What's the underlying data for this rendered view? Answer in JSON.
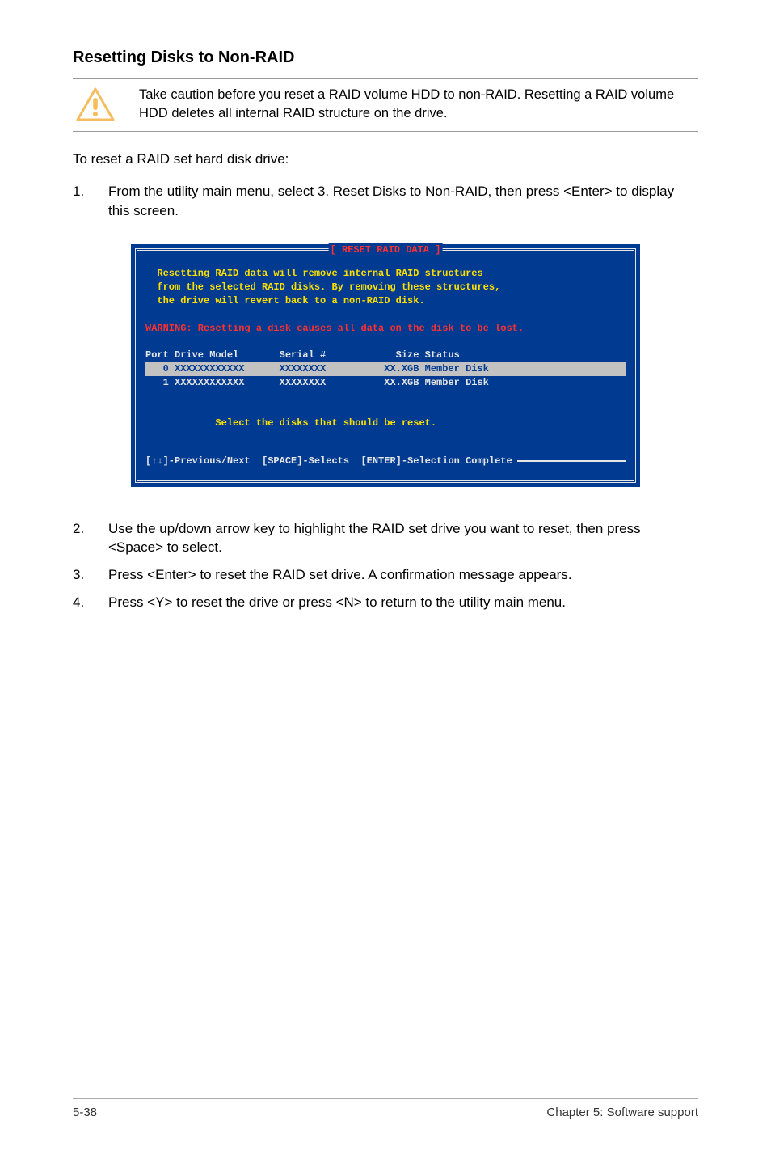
{
  "heading": "Resetting Disks to Non-RAID",
  "callout": {
    "text": "Take caution before you reset a RAID volume HDD to non-RAID. Resetting a RAID volume HDD deletes all internal RAID structure on the drive."
  },
  "intro": "To reset a RAID set hard disk drive:",
  "steps": [
    {
      "num": "1.",
      "text": "From the utility main menu, select 3. Reset Disks to Non-RAID, then press <Enter> to display this screen."
    }
  ],
  "terminal": {
    "title": "[ RESET RAID DATA ]",
    "msg1": "  Resetting RAID data will remove internal RAID structures",
    "msg2": "  from the selected RAID disks. By removing these structures,",
    "msg3": "  the drive will revert back to a non-RAID disk.",
    "warn": "WARNING: Resetting a disk causes all data on the disk to be lost.",
    "header": "Port Drive Model       Serial #            Size Status",
    "row0": "   0 XXXXXXXXXXXX      XXXXXXXX          XX.XGB Member Disk     ",
    "row1": "   1 XXXXXXXXXXXX      XXXXXXXX          XX.XGB Member Disk",
    "prompt": "            Select the disks that should be reset.",
    "help": "[↑↓]-Previous/Next  [SPACE]-Selects  [ENTER]-Selection Complete"
  },
  "steps_after": [
    {
      "num": "2.",
      "text": "Use the up/down arrow key to highlight the RAID set drive you want to reset, then press <Space> to select."
    },
    {
      "num": "3.",
      "text": "Press <Enter> to reset the RAID set drive. A confirmation message appears."
    },
    {
      "num": "4.",
      "text": "Press <Y> to reset the drive or press <N> to return to the utility main menu."
    }
  ],
  "footer": {
    "left": "5-38",
    "right": "Chapter 5: Software support"
  }
}
